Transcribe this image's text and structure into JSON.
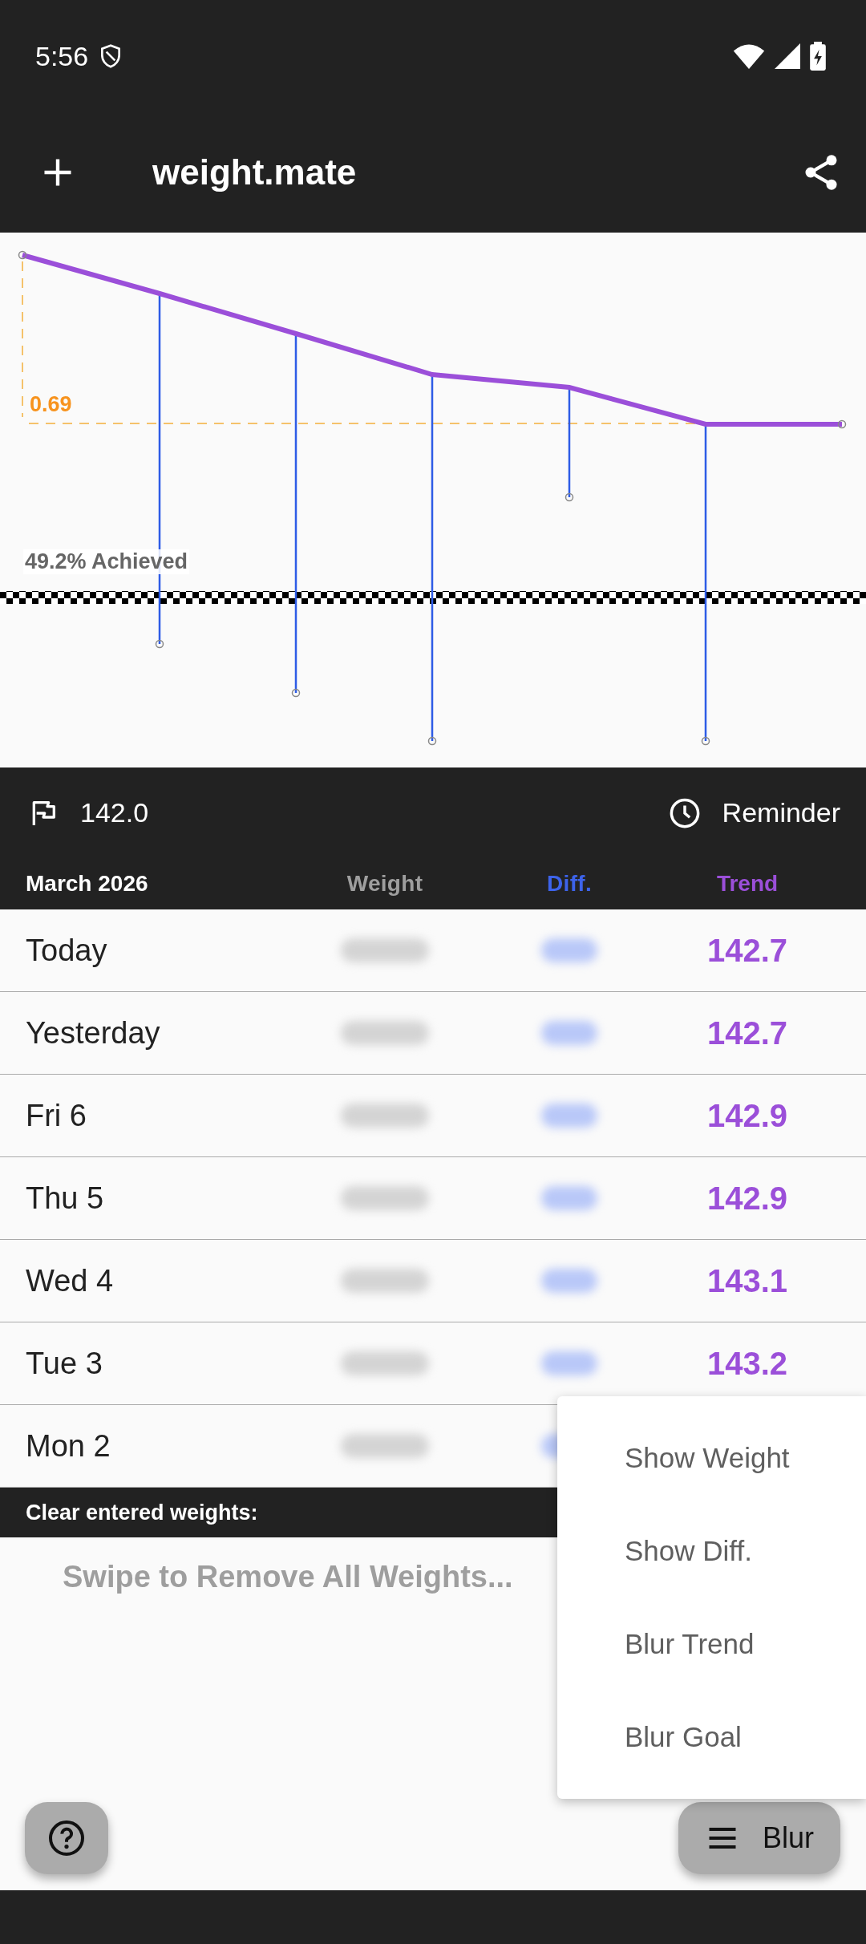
{
  "status_bar": {
    "time": "5:56"
  },
  "app_bar": {
    "title": "weight.mate"
  },
  "chart": {
    "goal_label": "0.69",
    "achieved_label": "49.2% Achieved"
  },
  "goal_bar": {
    "goal": "142.0",
    "reminder": "Reminder"
  },
  "table": {
    "month": "March 2026",
    "columns": [
      {
        "label": "Weight",
        "kind": "weight",
        "blurred": true
      },
      {
        "label": "Diff.",
        "kind": "diff",
        "blurred": true
      },
      {
        "label": "Trend",
        "kind": "trend",
        "blurred": false
      }
    ],
    "rows": [
      {
        "day": "Today",
        "trend": "142.7"
      },
      {
        "day": "Yesterday",
        "trend": "142.7"
      },
      {
        "day": "Fri 6",
        "trend": "142.9"
      },
      {
        "day": "Thu 5",
        "trend": "142.9"
      },
      {
        "day": "Wed 4",
        "trend": "143.1"
      },
      {
        "day": "Tue 3",
        "trend": "143.2"
      },
      {
        "day": "Mon 2"
      }
    ]
  },
  "clear_section": {
    "heading": "Clear entered weights:",
    "hint": "Swipe to Remove All Weights..."
  },
  "menu": {
    "items": [
      "Show Weight",
      "Show Diff.",
      "Blur Trend",
      "Blur Goal"
    ]
  },
  "blur_button": {
    "label": "Blur"
  }
}
